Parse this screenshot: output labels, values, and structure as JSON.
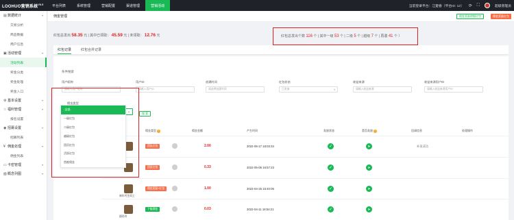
{
  "app": {
    "logo": "LOOHUO营销系统",
    "version": "V6.5"
  },
  "topnav": [
    {
      "label": "平台列表",
      "active": false
    },
    {
      "label": "系统管理",
      "active": false
    },
    {
      "label": "营销配置",
      "active": false
    },
    {
      "label": "渠道管理",
      "active": false
    },
    {
      "label": "营销活动",
      "active": true
    }
  ],
  "topright": {
    "platform": "当前登录平台：江楚春（平台ID: 12）",
    "user": "超级管理员"
  },
  "sidebar": [
    {
      "type": "group",
      "label": "数据统计",
      "icon": "chart-icon"
    },
    {
      "type": "item",
      "label": "交易分析"
    },
    {
      "type": "item",
      "label": "商品数据"
    },
    {
      "type": "item",
      "label": "用户信息"
    },
    {
      "type": "group",
      "label": "活动管理",
      "icon": "gift-icon"
    },
    {
      "type": "item",
      "label": "活动列表",
      "active": true
    },
    {
      "type": "item",
      "label": "奖金分类"
    },
    {
      "type": "item",
      "label": "奖金处理"
    },
    {
      "type": "item",
      "label": "奖金入口"
    },
    {
      "type": "group",
      "label": "基本设置",
      "icon": "gear-icon"
    },
    {
      "type": "group",
      "label": "福利管理",
      "icon": "star-icon"
    },
    {
      "type": "item",
      "label": "报名设置"
    },
    {
      "type": "group",
      "label": "招募设置",
      "icon": "user-icon"
    },
    {
      "type": "item",
      "label": "招募列表"
    },
    {
      "type": "group",
      "label": "佣金处理",
      "icon": "money-icon"
    },
    {
      "type": "item",
      "label": "佣金列表"
    },
    {
      "type": "group",
      "label": "卡密管理",
      "icon": "card-icon"
    },
    {
      "type": "group",
      "label": "概念列图",
      "icon": "image-icon"
    }
  ],
  "page": {
    "title": "佣金管理",
    "btn_outline": "佣金奖励明细红包",
    "btn_red": "佣金奖励红包"
  },
  "stats": {
    "total_label": "红包总发出",
    "total": "58.35",
    "unit": "元",
    "today_label": "| 其中已领取：",
    "today": "45.59",
    "unit2": "元",
    "pending_label": "| 未领取：",
    "pending": "12.76",
    "unit3": "元"
  },
  "stats2": {
    "count_label": "红包总发出个数",
    "count": "116",
    "unit": "个",
    "lv1_label": "| 其中一级",
    "lv1": "53",
    "lv2_label": "个 | 二级",
    "lv2": "5",
    "lv3_label": "个 | 越级",
    "lv3": "7",
    "lv4_label": "个 | 再邀",
    "lv4": "41",
    "tail": "个 ）"
  },
  "tabs": [
    {
      "label": "红包记录",
      "active": true
    },
    {
      "label": "红包合并记录",
      "active": false
    }
  ],
  "filters": {
    "section_title": "条件搜索",
    "fields": [
      {
        "label": "用户昵称",
        "placeholder": "请输入用户昵称"
      },
      {
        "label": "用户ID",
        "placeholder": "请输入用户ID"
      },
      {
        "label": "创建时间",
        "placeholder": "请选择创建时间"
      },
      {
        "label": "红包状态",
        "placeholder": "已发放"
      },
      {
        "label": "收益来源",
        "placeholder": "请输入收益来源"
      },
      {
        "label": "收益来源用户ID",
        "placeholder": "请输入收益来源用户ID"
      }
    ],
    "type_label": "佣金类型",
    "type_placeholder": "全部",
    "search_label": "搜 索",
    "options": [
      "-全部-",
      "一级红包",
      "二级红包",
      "越级红包",
      "团员红包",
      "活跃红包",
      "首推佣金"
    ]
  },
  "table": {
    "headers": [
      "佣金类型",
      "佣金金额",
      "产生时间",
      "发放状态",
      "是否发放",
      "回调信息",
      "处理操作"
    ],
    "rows": [
      {
        "type": "团队红包",
        "amount": "2.00",
        "time": "2022-06-17 18:03:34",
        "note": "补发成功"
      },
      {
        "type": "团员红包",
        "amount": "0.33",
        "time": "2022-05-06 16:57:23",
        "note": ""
      },
      {
        "type": "佣金奖励+红包",
        "amount": "1.00",
        "time": "2022-04-25 15:40:05",
        "note": "",
        "name": "林尔代生同工"
      },
      {
        "type": "下级佣金",
        "amount": "0.03",
        "time": "2022-04-11 18:54:21",
        "note": "",
        "name": "顾玲玲"
      }
    ]
  }
}
